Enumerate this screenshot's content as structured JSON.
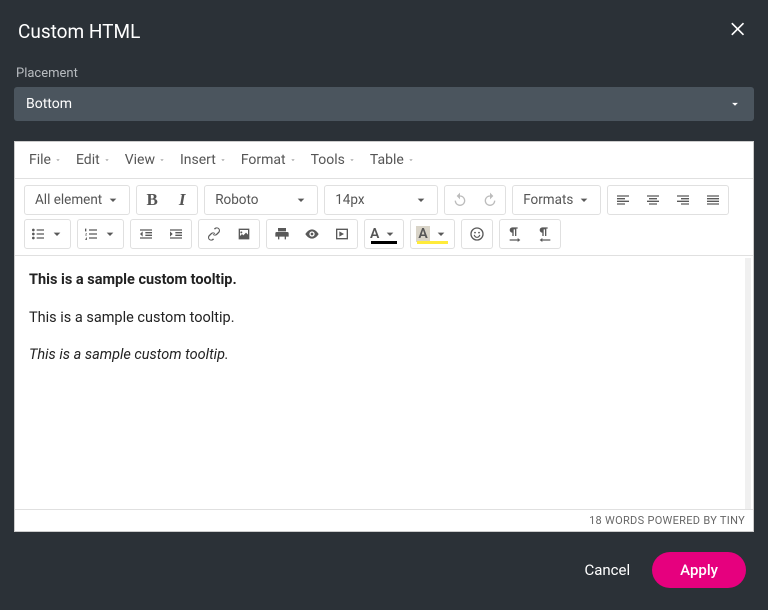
{
  "dialog": {
    "title": "Custom HTML",
    "placement_label": "Placement",
    "placement_value": "Bottom"
  },
  "menubar": {
    "file": "File",
    "edit": "Edit",
    "view": "View",
    "insert": "Insert",
    "format": "Format",
    "tools": "Tools",
    "table": "Table"
  },
  "toolbar": {
    "styleselect": "All element",
    "fontselect": "Roboto",
    "fontsize": "14px",
    "formats": "Formats"
  },
  "content": {
    "p1": "This is a sample custom tooltip.",
    "p2": "This is a sample custom tooltip.",
    "p3": "This is a sample custom tooltip."
  },
  "status": {
    "words": "18 WORDS",
    "powered": "POWERED BY TINY"
  },
  "footer": {
    "cancel": "Cancel",
    "apply": "Apply"
  }
}
